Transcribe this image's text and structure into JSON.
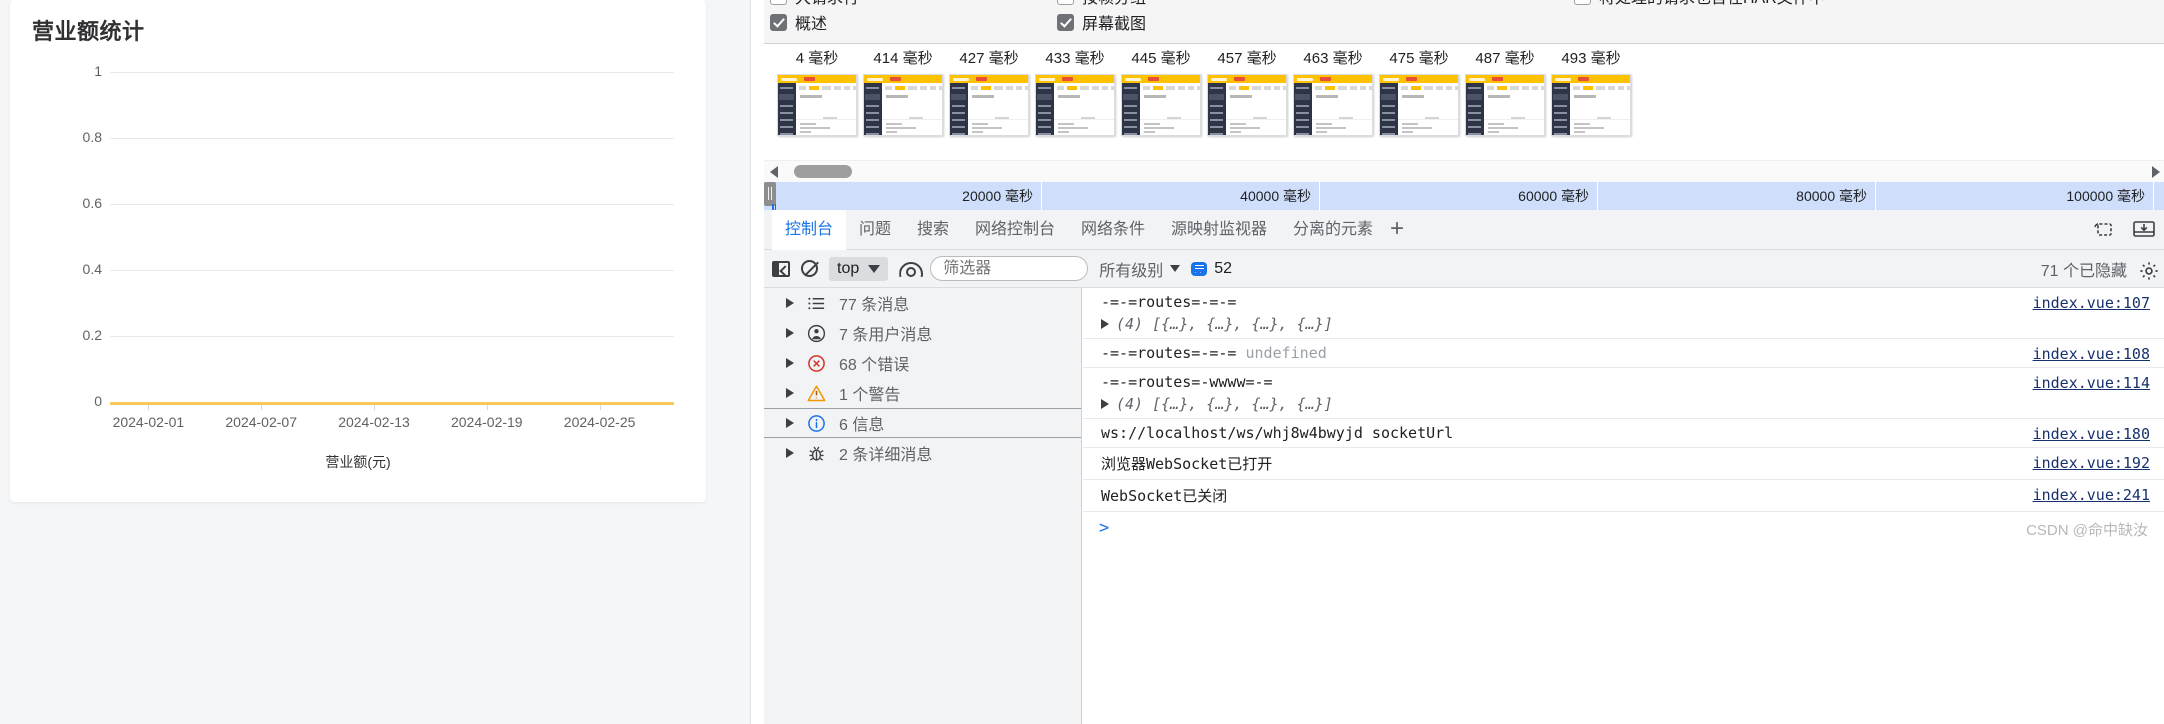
{
  "chart_panel": {
    "title": "营业额统计"
  },
  "chart_data": {
    "type": "line",
    "title": "营业额统计",
    "xlabel": "",
    "ylabel": "",
    "legend": [
      "营业额(元)"
    ],
    "legend_position": "bottom",
    "grid": true,
    "ylim": [
      0,
      1
    ],
    "yticks": [
      "0",
      "0.2",
      "0.4",
      "0.6",
      "0.8",
      "1"
    ],
    "categories": [
      "2024-02-01",
      "2024-02-07",
      "2024-02-13",
      "2024-02-19",
      "2024-02-25"
    ],
    "xticklabels": [
      "2024-02-01",
      "2024-02-07",
      "2024-02-13",
      "2024-02-19",
      "2024-02-25"
    ],
    "series": [
      {
        "name": "营业额(元)",
        "color": "#fac858",
        "values": [
          0,
          0,
          0,
          0,
          0
        ]
      }
    ]
  },
  "devtools": {
    "network_settings": {
      "checkboxes": [
        {
          "label": "大请求行",
          "checked": false
        },
        {
          "label": "按帧分组",
          "checked": false
        },
        {
          "label": "将处理的请求也含在HAR文件中",
          "checked": false
        },
        {
          "label": "概述",
          "checked": true
        },
        {
          "label": "屏幕截图",
          "checked": true
        }
      ]
    },
    "filmstrip": {
      "frames": [
        {
          "time": "4 毫秒"
        },
        {
          "time": "414 毫秒"
        },
        {
          "time": "427 毫秒"
        },
        {
          "time": "433 毫秒"
        },
        {
          "time": "445 毫秒"
        },
        {
          "time": "457 毫秒"
        },
        {
          "time": "463 毫秒"
        },
        {
          "time": "475 毫秒"
        },
        {
          "time": "487 毫秒"
        },
        {
          "time": "493 毫秒"
        }
      ]
    },
    "timeline_ruler": {
      "ticks": [
        "20000 毫秒",
        "40000 毫秒",
        "60000 毫秒",
        "80000 毫秒",
        "100000 毫秒"
      ]
    },
    "drawer_tabs": [
      {
        "label": "控制台",
        "active": true
      },
      {
        "label": "问题",
        "active": false
      },
      {
        "label": "搜索",
        "active": false
      },
      {
        "label": "网络控制台",
        "active": false
      },
      {
        "label": "网络条件",
        "active": false
      },
      {
        "label": "源映射监视器",
        "active": false
      },
      {
        "label": "分离的元素",
        "active": false
      }
    ],
    "drawer_add_label": "+",
    "console_toolbar": {
      "context_value": "top",
      "filter_placeholder": "筛选器",
      "filter_value": "",
      "level_label": "所有级别",
      "message_count": "52",
      "hidden_count": "71 个已隐藏"
    },
    "console_sidebar": [
      {
        "icon": "list-icon",
        "label": "77 条消息"
      },
      {
        "icon": "user-icon",
        "label": "7 条用户消息"
      },
      {
        "icon": "error-icon",
        "label": "68 个错误"
      },
      {
        "icon": "warning-icon",
        "label": "1 个警告"
      },
      {
        "icon": "info-icon",
        "label": "6 信息"
      },
      {
        "icon": "bug-icon",
        "label": "2 条详细消息"
      }
    ],
    "console_logs": [
      {
        "text": "-=-=routes=-=-=",
        "extra": "",
        "expandable": "(4) [{…}, {…}, {…}, {…}]",
        "source": "index.vue:107"
      },
      {
        "text": "-=-=routes=-=-=",
        "extra": "undefined",
        "expandable": "",
        "source": "index.vue:108"
      },
      {
        "text": "-=-=routes=-wwww=-=",
        "extra": "",
        "expandable": "(4) [{…}, {…}, {…}, {…}]",
        "source": "index.vue:114"
      },
      {
        "text": "ws://localhost/ws/whj8w4bwyjd socketUrl",
        "extra": "",
        "expandable": "",
        "source": "index.vue:180"
      },
      {
        "text": "浏览器WebSocket已打开",
        "extra": "",
        "expandable": "",
        "source": "index.vue:192"
      },
      {
        "text": "WebSocket已关闭",
        "extra": "",
        "expandable": "",
        "source": "index.vue:241"
      }
    ],
    "prompt_symbol": ">",
    "watermark": "CSDN @命中缺汝"
  }
}
